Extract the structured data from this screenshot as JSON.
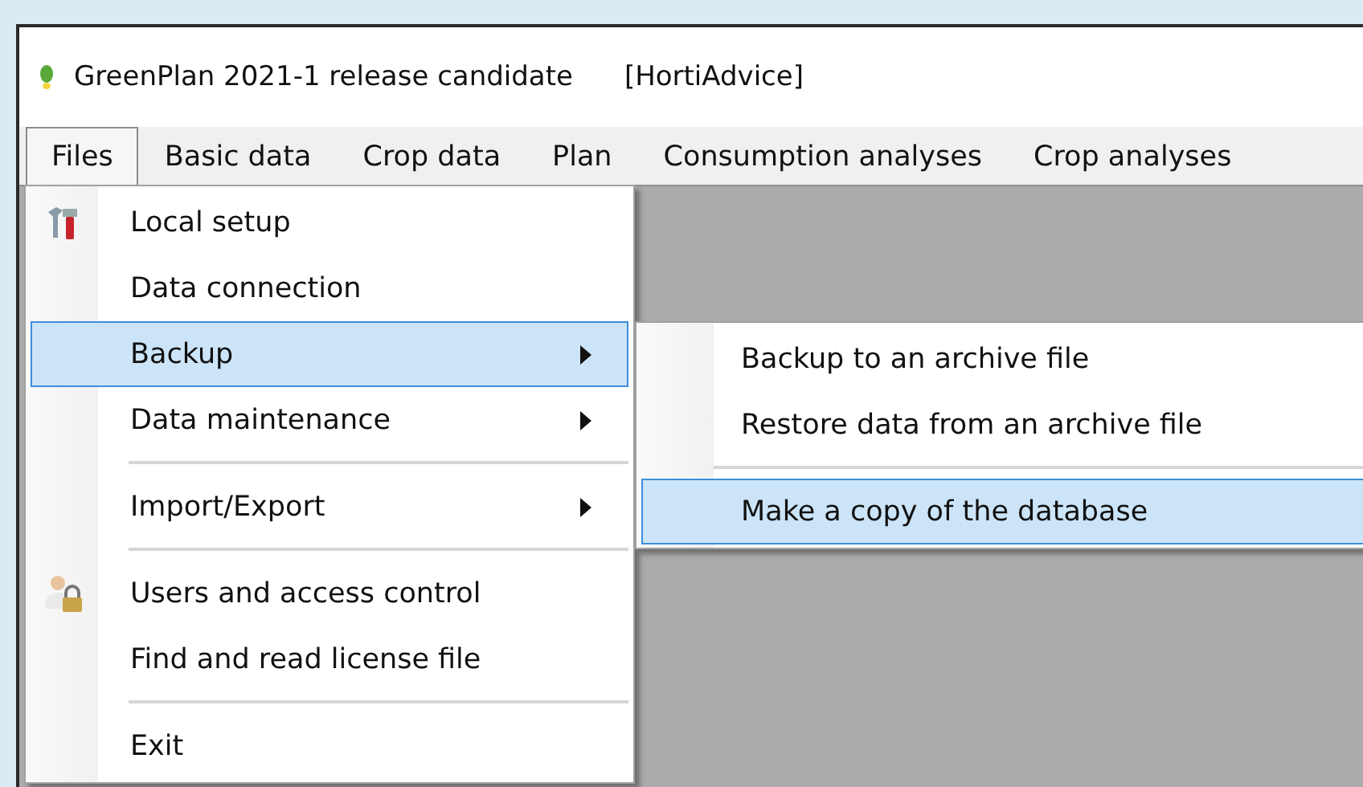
{
  "window": {
    "title": "GreenPlan 2021-1 release candidate",
    "subtitle": "[HortiAdvice]"
  },
  "menubar": [
    {
      "label": "Files",
      "selected": true
    },
    {
      "label": "Basic data",
      "selected": false
    },
    {
      "label": "Crop data",
      "selected": false
    },
    {
      "label": "Plan",
      "selected": false
    },
    {
      "label": "Consumption analyses",
      "selected": false
    },
    {
      "label": "Crop analyses",
      "selected": false
    }
  ],
  "files_menu": [
    {
      "kind": "tools",
      "label": "Local setup",
      "selected": false,
      "submenu": false
    },
    {
      "kind": "plain",
      "label": "Data connection",
      "selected": false,
      "submenu": false
    },
    {
      "kind": "plain",
      "label": "Backup",
      "selected": true,
      "submenu": true
    },
    {
      "kind": "plain",
      "label": "Data maintenance",
      "selected": false,
      "submenu": true
    },
    {
      "kind": "separator"
    },
    {
      "kind": "plain",
      "label": "Import/Export",
      "selected": false,
      "submenu": true
    },
    {
      "kind": "separator"
    },
    {
      "kind": "users",
      "label": "Users and access control",
      "selected": false,
      "submenu": false
    },
    {
      "kind": "plain",
      "label": "Find and read license file",
      "selected": false,
      "submenu": false
    },
    {
      "kind": "separator"
    },
    {
      "kind": "plain",
      "label": "Exit",
      "selected": false,
      "submenu": false
    }
  ],
  "backup_submenu": [
    {
      "kind": "plain",
      "label": "Backup to an archive file",
      "selected": false
    },
    {
      "kind": "plain",
      "label": "Restore data from an archive file",
      "selected": false
    },
    {
      "kind": "separator"
    },
    {
      "kind": "plain",
      "label": "Make a copy of the database",
      "selected": true
    }
  ]
}
